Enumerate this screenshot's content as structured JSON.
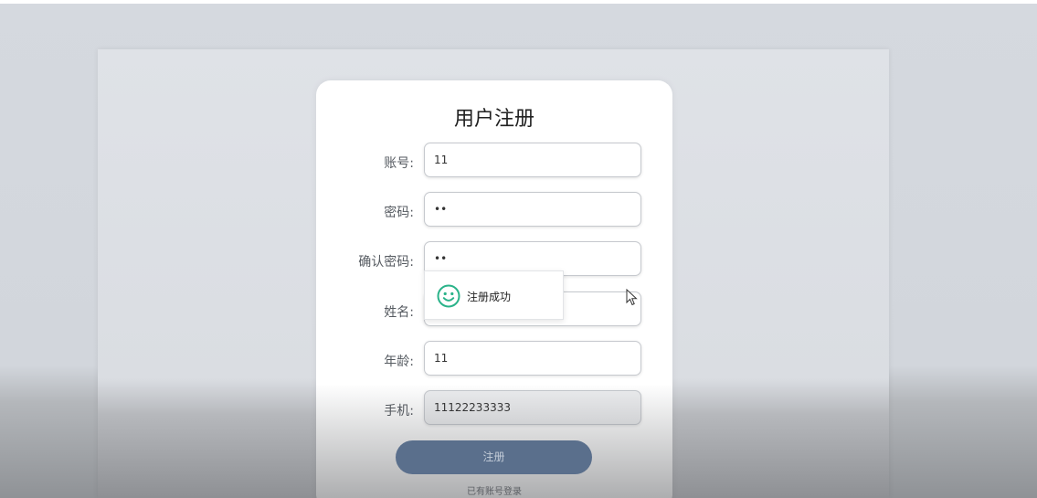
{
  "form": {
    "title": "用户注册",
    "fields": [
      {
        "label": "账号:",
        "value": "11"
      },
      {
        "label": "密码:",
        "value": "••"
      },
      {
        "label": "确认密码:",
        "value": "••"
      },
      {
        "label": "姓名:",
        "value": ""
      },
      {
        "label": "年龄:",
        "value": "11"
      },
      {
        "label": "手机:",
        "value": "11122233333"
      }
    ],
    "submit_label": "注册",
    "login_link": "已有账号登录"
  },
  "toast": {
    "message": "注册成功",
    "icon": "smile-icon",
    "color": "#2bb38a"
  },
  "colors": {
    "button": "#5a6f8c",
    "background": "#d3d7dd"
  }
}
